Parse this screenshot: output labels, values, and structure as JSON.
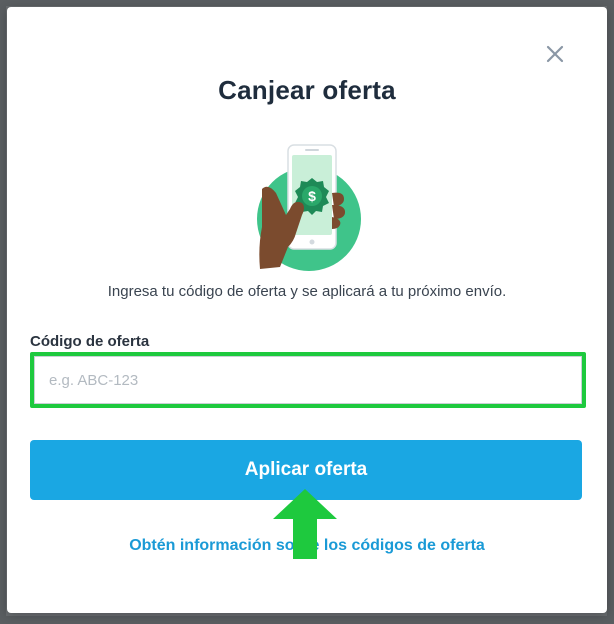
{
  "modal": {
    "title": "Canjear oferta",
    "description": "Ingresa tu código de oferta y se aplicará a tu próximo envío.",
    "field_label": "Código de oferta",
    "input_value": "",
    "input_placeholder": "e.g. ABC-123",
    "apply_button_label": "Aplicar oferta",
    "info_link_label": "Obtén información sobre los códigos de oferta",
    "close_icon": "close-icon",
    "illustration": "hand-holding-phone-with-dollar-badge"
  },
  "colors": {
    "title": "#1f2d3d",
    "accent_blue": "#1aa7e3",
    "link_blue": "#1a9ad6",
    "highlight_green": "#1ec93e",
    "illustration_green": "#3fc48a"
  }
}
